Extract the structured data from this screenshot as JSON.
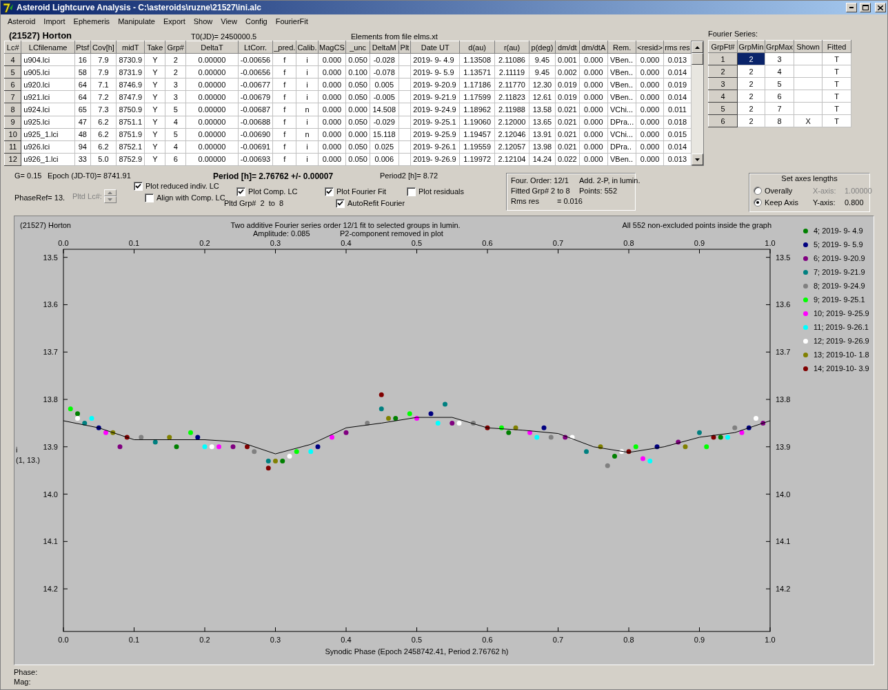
{
  "window": {
    "title": "Asteroid Lightcurve Analysis - C:\\asteroids\\ruzne\\21527\\ini.alc"
  },
  "menu": [
    "Asteroid",
    "Import",
    "Ephemeris",
    "Manipulate",
    "Export",
    "Show",
    "View",
    "Config",
    "FourierFit"
  ],
  "header": {
    "object": "(21527) Horton",
    "t0": "T0(JD)= 2450000.5",
    "elements": "Elements from file elms.xt"
  },
  "table": {
    "columns": [
      "Lc#",
      "LCfilename",
      "Ptsf",
      "Cov[h]",
      "midT",
      "Take",
      "Grp#",
      "DeltaT",
      "LtCorr.",
      "_pred.",
      "Calib.",
      "MagCS",
      "_unc",
      "DeltaM",
      "Plt",
      "Date UT",
      "d(au)",
      "r(au)",
      "p(deg)",
      "dm/dt",
      "dm/dtA",
      "Rem.",
      "<resid>",
      "rms res"
    ],
    "rows": [
      {
        "lc": "4",
        "file": "u904.lci",
        "ptsf": "16",
        "cov": "7.9",
        "midT": "8730.9",
        "take": "Y",
        "grp": "2",
        "deltaT": "0.00000",
        "ltcorr": "-0.00656",
        "pred": "f",
        "calib": "i",
        "magcs": "0.000",
        "unc": "0.050",
        "deltaM": "-0.028",
        "date": "2019- 9- 4.9",
        "d": "1.13508",
        "r": "2.11086",
        "p": "9.45",
        "dmdt": "0.001",
        "dmdta": "0.000",
        "rem": "VBen..",
        "resid": "0.000",
        "rms": "0.013"
      },
      {
        "lc": "5",
        "file": "u905.lci",
        "ptsf": "58",
        "cov": "7.9",
        "midT": "8731.9",
        "take": "Y",
        "grp": "2",
        "deltaT": "0.00000",
        "ltcorr": "-0.00656",
        "pred": "f",
        "calib": "i",
        "magcs": "0.000",
        "unc": "0.100",
        "deltaM": "-0.078",
        "date": "2019- 9- 5.9",
        "d": "1.13571",
        "r": "2.11119",
        "p": "9.45",
        "dmdt": "0.002",
        "dmdta": "0.000",
        "rem": "VBen..",
        "resid": "0.000",
        "rms": "0.014"
      },
      {
        "lc": "6",
        "file": "u920.lci",
        "ptsf": "64",
        "cov": "7.1",
        "midT": "8746.9",
        "take": "Y",
        "grp": "3",
        "deltaT": "0.00000",
        "ltcorr": "-0.00677",
        "pred": "f",
        "calib": "i",
        "magcs": "0.000",
        "unc": "0.050",
        "deltaM": "0.005",
        "date": "2019- 9-20.9",
        "d": "1.17186",
        "r": "2.11770",
        "p": "12.30",
        "dmdt": "0.019",
        "dmdta": "0.000",
        "rem": "VBen..",
        "resid": "0.000",
        "rms": "0.019"
      },
      {
        "lc": "7",
        "file": "u921.lci",
        "ptsf": "64",
        "cov": "7.2",
        "midT": "8747.9",
        "take": "Y",
        "grp": "3",
        "deltaT": "0.00000",
        "ltcorr": "-0.00679",
        "pred": "f",
        "calib": "i",
        "magcs": "0.000",
        "unc": "0.050",
        "deltaM": "-0.005",
        "date": "2019- 9-21.9",
        "d": "1.17599",
        "r": "2.11823",
        "p": "12.61",
        "dmdt": "0.019",
        "dmdta": "0.000",
        "rem": "VBen..",
        "resid": "0.000",
        "rms": "0.014"
      },
      {
        "lc": "8",
        "file": "u924.lci",
        "ptsf": "65",
        "cov": "7.3",
        "midT": "8750.9",
        "take": "Y",
        "grp": "5",
        "deltaT": "0.00000",
        "ltcorr": "-0.00687",
        "pred": "f",
        "calib": "n",
        "magcs": "0.000",
        "unc": "0.000",
        "deltaM": "14.508",
        "date": "2019- 9-24.9",
        "d": "1.18962",
        "r": "2.11988",
        "p": "13.58",
        "dmdt": "0.021",
        "dmdta": "0.000",
        "rem": "VChi...",
        "resid": "0.000",
        "rms": "0.011"
      },
      {
        "lc": "9",
        "file": "u925.lci",
        "ptsf": "47",
        "cov": "6.2",
        "midT": "8751.1",
        "take": "Y",
        "grp": "4",
        "deltaT": "0.00000",
        "ltcorr": "-0.00688",
        "pred": "f",
        "calib": "i",
        "magcs": "0.000",
        "unc": "0.050",
        "deltaM": "-0.029",
        "date": "2019- 9-25.1",
        "d": "1.19060",
        "r": "2.12000",
        "p": "13.65",
        "dmdt": "0.021",
        "dmdta": "0.000",
        "rem": "DPra...",
        "resid": "0.000",
        "rms": "0.018"
      },
      {
        "lc": "10",
        "file": "u925_1.lci",
        "ptsf": "48",
        "cov": "6.2",
        "midT": "8751.9",
        "take": "Y",
        "grp": "5",
        "deltaT": "0.00000",
        "ltcorr": "-0.00690",
        "pred": "f",
        "calib": "n",
        "magcs": "0.000",
        "unc": "0.000",
        "deltaM": "15.118",
        "date": "2019- 9-25.9",
        "d": "1.19457",
        "r": "2.12046",
        "p": "13.91",
        "dmdt": "0.021",
        "dmdta": "0.000",
        "rem": "VChi...",
        "resid": "0.000",
        "rms": "0.015"
      },
      {
        "lc": "11",
        "file": "u926.lci",
        "ptsf": "94",
        "cov": "6.2",
        "midT": "8752.1",
        "take": "Y",
        "grp": "4",
        "deltaT": "0.00000",
        "ltcorr": "-0.00691",
        "pred": "f",
        "calib": "i",
        "magcs": "0.000",
        "unc": "0.050",
        "deltaM": "0.025",
        "date": "2019- 9-26.1",
        "d": "1.19559",
        "r": "2.12057",
        "p": "13.98",
        "dmdt": "0.021",
        "dmdta": "0.000",
        "rem": "DPra..",
        "resid": "0.000",
        "rms": "0.014"
      },
      {
        "lc": "12",
        "file": "u926_1.lci",
        "ptsf": "33",
        "cov": "5.0",
        "midT": "8752.9",
        "take": "Y",
        "grp": "6",
        "deltaT": "0.00000",
        "ltcorr": "-0.00693",
        "pred": "f",
        "calib": "i",
        "magcs": "0.000",
        "unc": "0.050",
        "deltaM": "0.006",
        "date": "2019- 9-26.9",
        "d": "1.19972",
        "r": "2.12104",
        "p": "14.24",
        "dmdt": "0.022",
        "dmdta": "0.000",
        "rem": "VBen..",
        "resid": "0.000",
        "rms": "0.013"
      }
    ]
  },
  "fourier_series": {
    "title": "Fourier Series:",
    "columns": [
      "GrpFt#",
      "GrpMin",
      "GrpMax",
      "Shown",
      "Fitted"
    ],
    "rows": [
      {
        "n": "1",
        "min": "2",
        "max": "3",
        "fitted": "T",
        "selected": true
      },
      {
        "n": "2",
        "min": "2",
        "max": "4",
        "fitted": "T",
        "selected": false
      },
      {
        "n": "3",
        "min": "2",
        "max": "5",
        "fitted": "T",
        "selected": false
      },
      {
        "n": "4",
        "min": "2",
        "max": "6",
        "fitted": "T",
        "selected": false
      },
      {
        "n": "5",
        "min": "2",
        "max": "7",
        "fitted": "T",
        "selected": false
      },
      {
        "n": "6",
        "min": "2",
        "max": "8",
        "shown": "X",
        "fitted": "T",
        "selected": false
      }
    ]
  },
  "info": {
    "g": "G= 0.15",
    "epoch": "Epoch (JD-T0)= 8741.91",
    "period": "Period [h]= 2.76762 +/- 0.00007",
    "period2": "Period2 [h]= 8.72",
    "phase_ref": "PhaseRef= 13."
  },
  "plotted_lc": {
    "label": "Pltd Lc#:",
    "disabled": true
  },
  "plot_options": [
    {
      "label": "Plot reduced indiv. LC",
      "checked": true
    },
    {
      "label": "Align with Comp. LC",
      "checked": false
    },
    {
      "label": "Plot Comp. LC",
      "checked": true
    },
    {
      "label": "Plot Fourier Fit",
      "checked": true
    },
    {
      "label": "AutoRefit Fourier",
      "checked": true
    },
    {
      "label": "Plot residuals",
      "checked": false
    }
  ],
  "plotted_groups": "Pltd Grp#  2  to  8",
  "fourier_summary": {
    "order": "Four. Order: 12/1",
    "mode": "Add. 2-P, in lumin.",
    "fitted": "Fitted Grp# 2 to 8",
    "points": "Points: 552",
    "rms_label": "Rms res",
    "rms_value": "= 0.016"
  },
  "axes_lengths": {
    "title": "Set axes lengths",
    "options": [
      {
        "label": "Overally",
        "selected": false,
        "axis": "X-axis:",
        "value": "1.00000",
        "disabled": true
      },
      {
        "label": "Keep Axis",
        "selected": true,
        "axis": "Y-axis:",
        "value": "0.800",
        "disabled": false
      }
    ]
  },
  "chart": {
    "object": "(21527) Horton",
    "amplitude": "Amplitude: 0.085",
    "note": "P2-component removed in plot",
    "points_note": "All 552 non-excluded points inside the graph",
    "ylabel_note": "(1, 13.)",
    "chart_data": {
      "type": "scatter",
      "title": "Two additive Fourier series order 12/1 fit to selected groups in lumin.",
      "xlabel": "Synodic Phase (Epoch 2458742.41, Period 2.76762 h)",
      "ylabel": "i",
      "xlim": [
        0,
        1
      ],
      "ylim": [
        14.29,
        13.483
      ],
      "xticks": [
        {
          "value": 0,
          "label": "0.0"
        },
        {
          "value": 0.1,
          "label": "0.1"
        },
        {
          "value": 0.2,
          "label": "0.2"
        },
        {
          "value": 0.3,
          "label": "0.3"
        },
        {
          "value": 0.4,
          "label": "0.4"
        },
        {
          "value": 0.5,
          "label": "0.5"
        },
        {
          "value": 0.6,
          "label": "0.6"
        },
        {
          "value": 0.7,
          "label": "0.7"
        },
        {
          "value": 0.8,
          "label": "0.8"
        },
        {
          "value": 0.9,
          "label": "0.9"
        },
        {
          "value": 1,
          "label": "1.0"
        }
      ],
      "yticks": [
        {
          "value": 13.5,
          "label": "13.5"
        },
        {
          "value": 13.6,
          "label": "13.6"
        },
        {
          "value": 13.7,
          "label": "13.7"
        },
        {
          "value": 13.8,
          "label": "13.8"
        },
        {
          "value": 13.9,
          "label": "13.9"
        },
        {
          "value": 14,
          "label": "14.0"
        },
        {
          "value": 14.1,
          "label": "14.1"
        },
        {
          "value": 14.2,
          "label": "14.2"
        }
      ],
      "series": [
        {
          "name": "4; 2019- 9- 4.9",
          "color": "#008000",
          "type": "scatter",
          "x": [
            0.02,
            0.16,
            0.31,
            0.47,
            0.63,
            0.78,
            0.93
          ],
          "values": [
            13.83,
            13.9,
            13.93,
            13.84,
            13.87,
            13.92,
            13.88
          ]
        },
        {
          "name": "5; 2019- 9- 5.9",
          "color": "#000080",
          "type": "scatter",
          "x": [
            0.05,
            0.19,
            0.36,
            0.52,
            0.68,
            0.84,
            0.97
          ],
          "values": [
            13.86,
            13.88,
            13.9,
            13.83,
            13.86,
            13.9,
            13.86
          ]
        },
        {
          "name": "6; 2019- 9-20.9",
          "color": "#800080",
          "type": "scatter",
          "x": [
            0.08,
            0.24,
            0.4,
            0.55,
            0.71,
            0.87,
            0.99
          ],
          "values": [
            13.9,
            13.9,
            13.87,
            13.85,
            13.88,
            13.89,
            13.85
          ]
        },
        {
          "name": "7; 2019- 9-21.9",
          "color": "#008080",
          "type": "scatter",
          "x": [
            0.03,
            0.13,
            0.29,
            0.45,
            0.54,
            0.74,
            0.9
          ],
          "values": [
            13.85,
            13.89,
            13.93,
            13.82,
            13.81,
            13.91,
            13.87
          ]
        },
        {
          "name": "8; 2019- 9-24.9",
          "color": "#808080",
          "type": "scatter",
          "x": [
            0.11,
            0.27,
            0.43,
            0.58,
            0.69,
            0.77,
            0.95
          ],
          "values": [
            13.88,
            13.91,
            13.85,
            13.85,
            13.88,
            13.94,
            13.86
          ]
        },
        {
          "name": "9; 2019- 9-25.1",
          "color": "#00ff00",
          "type": "scatter",
          "x": [
            0.01,
            0.18,
            0.33,
            0.49,
            0.62,
            0.81,
            0.91
          ],
          "values": [
            13.82,
            13.87,
            13.91,
            13.83,
            13.86,
            13.9,
            13.9
          ]
        },
        {
          "name": "10; 2019- 9-25.9",
          "color": "#ff00ff",
          "type": "scatter",
          "x": [
            0.06,
            0.22,
            0.38,
            0.5,
            0.66,
            0.82,
            0.96
          ],
          "values": [
            13.87,
            13.9,
            13.88,
            13.84,
            13.87,
            13.925,
            13.87
          ]
        },
        {
          "name": "11; 2019- 9-26.1",
          "color": "#00ffff",
          "type": "scatter",
          "x": [
            0.04,
            0.2,
            0.35,
            0.53,
            0.67,
            0.83,
            0.94
          ],
          "values": [
            13.84,
            13.9,
            13.91,
            13.85,
            13.88,
            13.93,
            13.88
          ]
        },
        {
          "name": "12; 2019- 9-26.9",
          "color": "#ffffff",
          "type": "scatter",
          "x": [
            0.02,
            0.21,
            0.32,
            0.56,
            0.72,
            0.79,
            0.98
          ],
          "values": [
            13.84,
            13.9,
            13.92,
            13.85,
            13.88,
            13.91,
            13.84
          ]
        },
        {
          "name": "13; 2019-10- 1.8",
          "color": "#808000",
          "type": "scatter",
          "x": [
            0.07,
            0.15,
            0.3,
            0.46,
            0.64,
            0.76,
            0.88
          ],
          "values": [
            13.87,
            13.88,
            13.93,
            13.84,
            13.86,
            13.9,
            13.9
          ]
        },
        {
          "name": "14; 2019-10- 3.9",
          "color": "#800000",
          "type": "scatter",
          "x": [
            0.09,
            0.26,
            0.29,
            0.45,
            0.6,
            0.8,
            0.92
          ],
          "values": [
            13.88,
            13.9,
            13.945,
            13.79,
            13.86,
            13.91,
            13.88
          ]
        },
        {
          "color": "#000000",
          "type": "line",
          "x": [
            0,
            0.05,
            0.1,
            0.15,
            0.2,
            0.25,
            0.3,
            0.35,
            0.4,
            0.45,
            0.5,
            0.55,
            0.6,
            0.65,
            0.7,
            0.75,
            0.8,
            0.85,
            0.9,
            0.95,
            1
          ],
          "values": [
            13.845,
            13.86,
            13.885,
            13.885,
            13.885,
            13.89,
            13.915,
            13.895,
            13.86,
            13.85,
            13.838,
            13.838,
            13.86,
            13.865,
            13.872,
            13.9,
            13.912,
            13.9,
            13.88,
            13.87,
            13.845
          ]
        }
      ]
    }
  },
  "status": {
    "phase": "Phase:",
    "mag": "Mag:"
  }
}
